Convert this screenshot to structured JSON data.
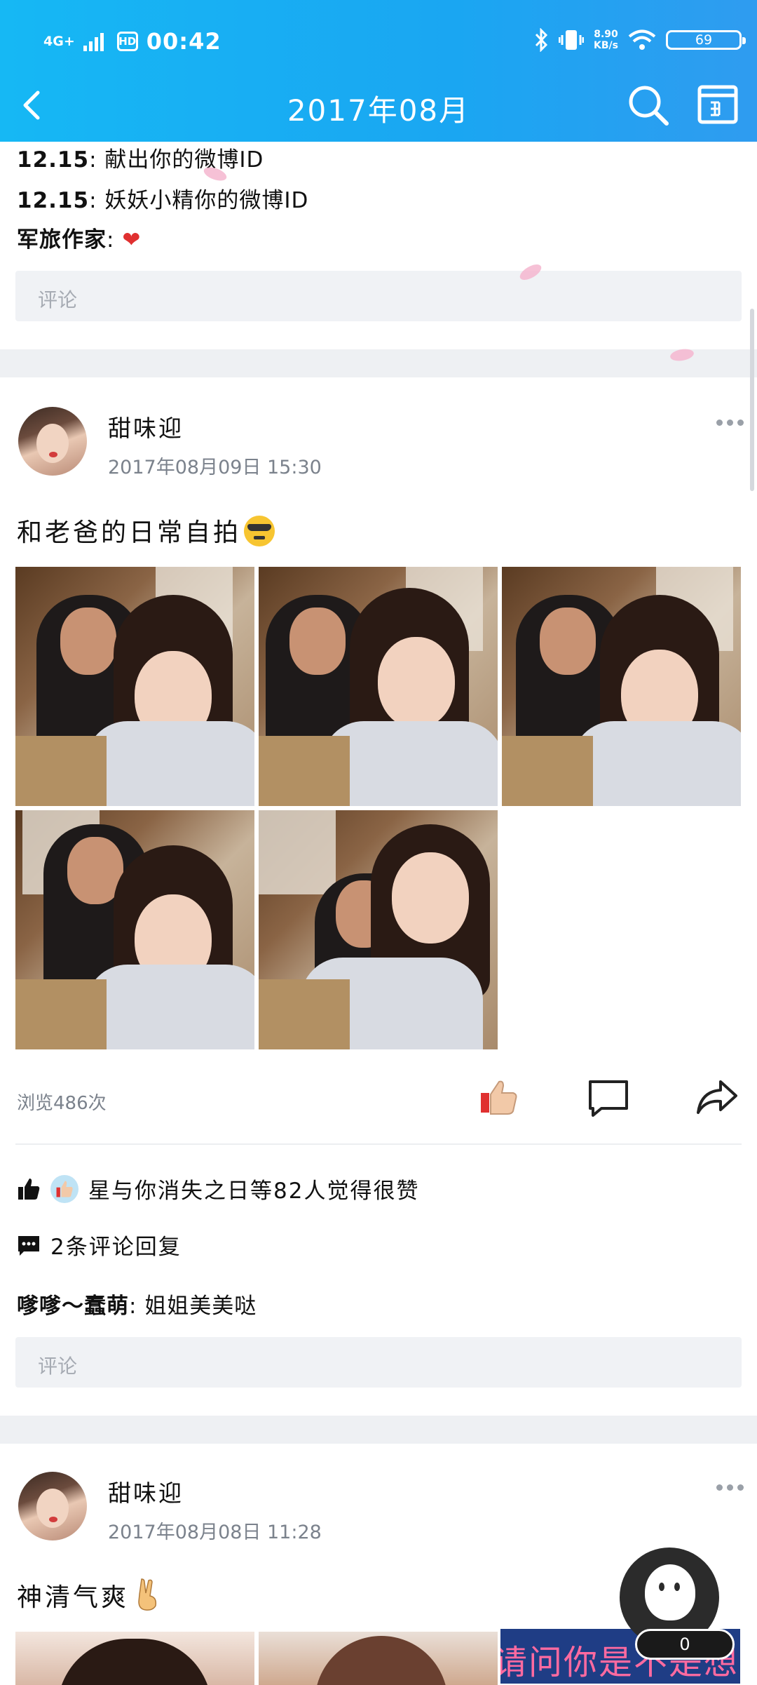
{
  "status_bar": {
    "network": "4G+",
    "hd": "HD",
    "time": "00:42",
    "speed_value": "8.90",
    "speed_unit": "KB/s",
    "battery": "69"
  },
  "nav": {
    "title": "2017年08月"
  },
  "prev_post": {
    "comments": [
      {
        "user": "12.15",
        "text": "献出你的微博ID"
      },
      {
        "user": "12.15",
        "text": "妖妖小精你的微博ID"
      },
      {
        "user": "军旅作家",
        "text": "❤"
      }
    ],
    "comment_placeholder": "评论"
  },
  "post1": {
    "author": "甜味迎",
    "time": "2017年08月09日  15:30",
    "text": "和老爸的日常自拍",
    "views": "浏览486次",
    "likes_text": "星与你消失之日等82人觉得很赞",
    "reply_count_text": "2条评论回复",
    "comment": {
      "user": "嗲嗲～蠢萌",
      "text": "姐姐美美哒"
    },
    "comment_placeholder": "评论"
  },
  "post2": {
    "author": "甜味迎",
    "time": "2017年08月08日  11:28",
    "text": "神清气爽",
    "image_caption": "请问你是不是想热死我"
  },
  "floating_badge": {
    "count": "0"
  },
  "colors": {
    "header": "#1aa6f2",
    "accent_red": "#e03030",
    "muted": "#7b828c"
  }
}
